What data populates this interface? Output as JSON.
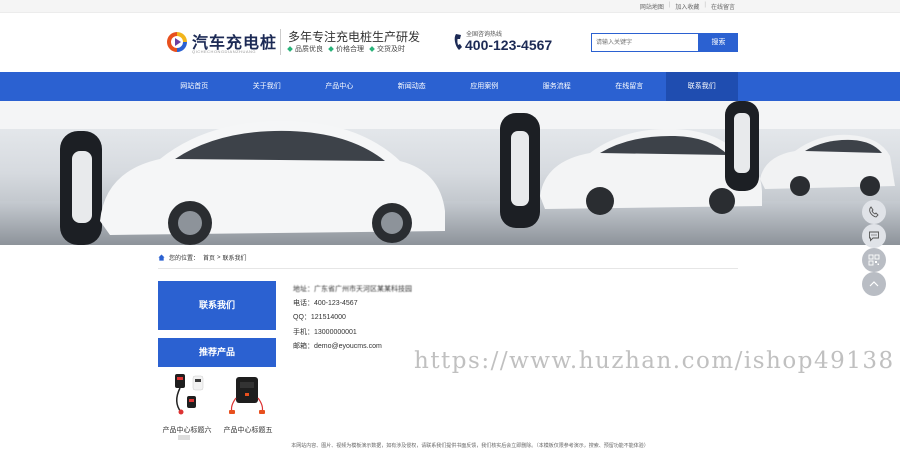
{
  "topbar": {
    "links": [
      "网站地图",
      "加入收藏",
      "在线留言"
    ]
  },
  "header": {
    "logo_text": "汽车充电桩",
    "logo_sub": "QICHECHONGDIANZHUANG",
    "slogan": "多年专注充电桩生产研发",
    "features": [
      "品质优良",
      "价格合理",
      "交货及时"
    ],
    "hotline_label": "全国咨询热线",
    "hotline_number": "400-123-4567",
    "search_placeholder": "请输入关键字",
    "search_button": "搜索"
  },
  "nav": {
    "items": [
      "网站首页",
      "关于我们",
      "产品中心",
      "新闻动态",
      "应用案例",
      "服务流程",
      "在线留言",
      "联系我们"
    ],
    "active_index": 7
  },
  "breadcrumb": {
    "label": "您的位置：",
    "home": "首页",
    "separator": ">",
    "current": "联系我们"
  },
  "sidebar": {
    "contact_title": "联系我们",
    "products_title": "推荐产品",
    "products": [
      {
        "name": "产品中心标题六"
      },
      {
        "name": "产品中心标题五"
      }
    ]
  },
  "contact_info": {
    "address": "地址：广东省广州市天河区某某科技园",
    "phone": "电话：400-123-4567",
    "qq": "QQ：121514000",
    "mobile": "手机：13000000001",
    "email": "邮箱：demo@eyoucms.com"
  },
  "watermark": "https://www.huzhan.com/ishop49138",
  "footer": {
    "text": "本网站内容、图片、视频为模板演示数据，如有涉及侵权，请联系我们提供书面反馈，我们核实后会立即删除。（本模板仅限参考演示，搜索、预留功能不能体验）"
  },
  "colors": {
    "brand_blue": "#2b61d1",
    "nav_active": "#1f4db0",
    "logo_navy": "#1c2a55",
    "feature_green": "#2ab37a"
  },
  "icons": [
    "logo-icon",
    "phone-icon",
    "home-icon",
    "phone-float-icon",
    "chat-icon",
    "qrcode-icon",
    "back-to-top-icon"
  ]
}
